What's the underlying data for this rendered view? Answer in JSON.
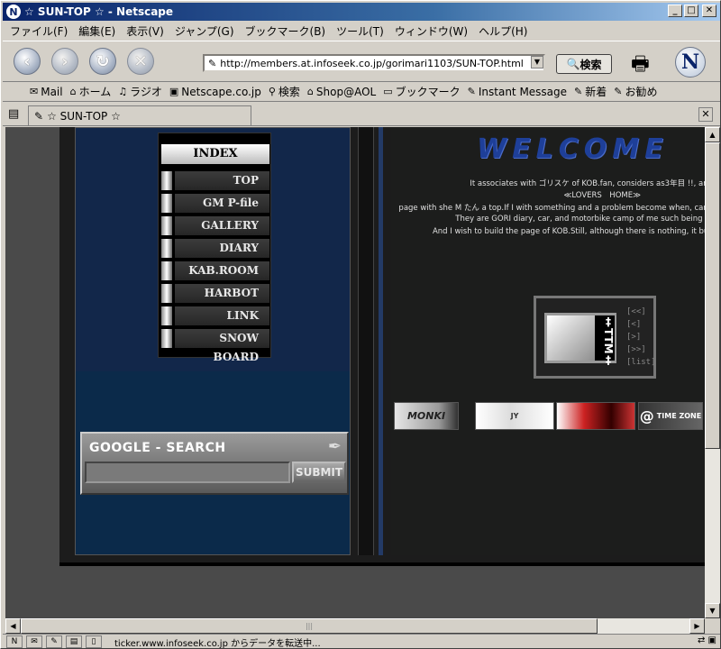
{
  "window": {
    "title": "☆ SUN-TOP ☆ - Netscape",
    "min": "_",
    "max": "□",
    "close": "✕"
  },
  "menu": [
    "ファイル(F)",
    "編集(E)",
    "表示(V)",
    "ジャンプ(G)",
    "ブックマーク(B)",
    "ツール(T)",
    "ウィンドウ(W)",
    "ヘルプ(H)"
  ],
  "nav": {
    "back": "‹",
    "forward": "›",
    "reload": "↻",
    "stop": "✕",
    "url": "http://members.at.infoseek.co.jp/gorimari1103/SUN-TOP.html",
    "search_label": "検索"
  },
  "personal_toolbar": [
    "Mail",
    "ホーム",
    "ラジオ",
    "Netscape.co.jp",
    "検索",
    "Shop@AOL",
    "ブックマーク",
    "Instant Message",
    "新着",
    "お勧め"
  ],
  "tab": {
    "label": "☆ SUN-TOP ☆"
  },
  "page": {
    "index": {
      "header": "INDEX",
      "items": [
        "TOP",
        "GM P-file",
        "GALLERY",
        "DIARY",
        "KAB.ROOM",
        "HARBOT",
        "LINK",
        "SNOW BOARD"
      ]
    },
    "google": {
      "title": "GOOGLE - SEARCH",
      "submit": "SUBMIT",
      "value": ""
    },
    "welcome": "WELCOME",
    "messages": [
      "It associates with ゴリスケ of KOB.fan, considers as3年目 !!, and",
      "≪LOVERS　HOME≫",
      "page with she M たん a top.If I with something and a problem become when, can I",
      "They are GORI diary, car, and motorbike camp of me such being th",
      "And I wish to build the page of KOB.Still, although there is nothing, it buil"
    ],
    "ring": {
      "logo": "‡TTM‡",
      "links": [
        "[<<]",
        "[<]",
        "[>]",
        "[>>]",
        "[list]"
      ]
    },
    "banners": [
      "MONKI",
      "JY",
      "",
      "TIME ZONE"
    ]
  },
  "status": {
    "text": "ticker.www.infoseek.co.jp からデータを転送中..."
  }
}
